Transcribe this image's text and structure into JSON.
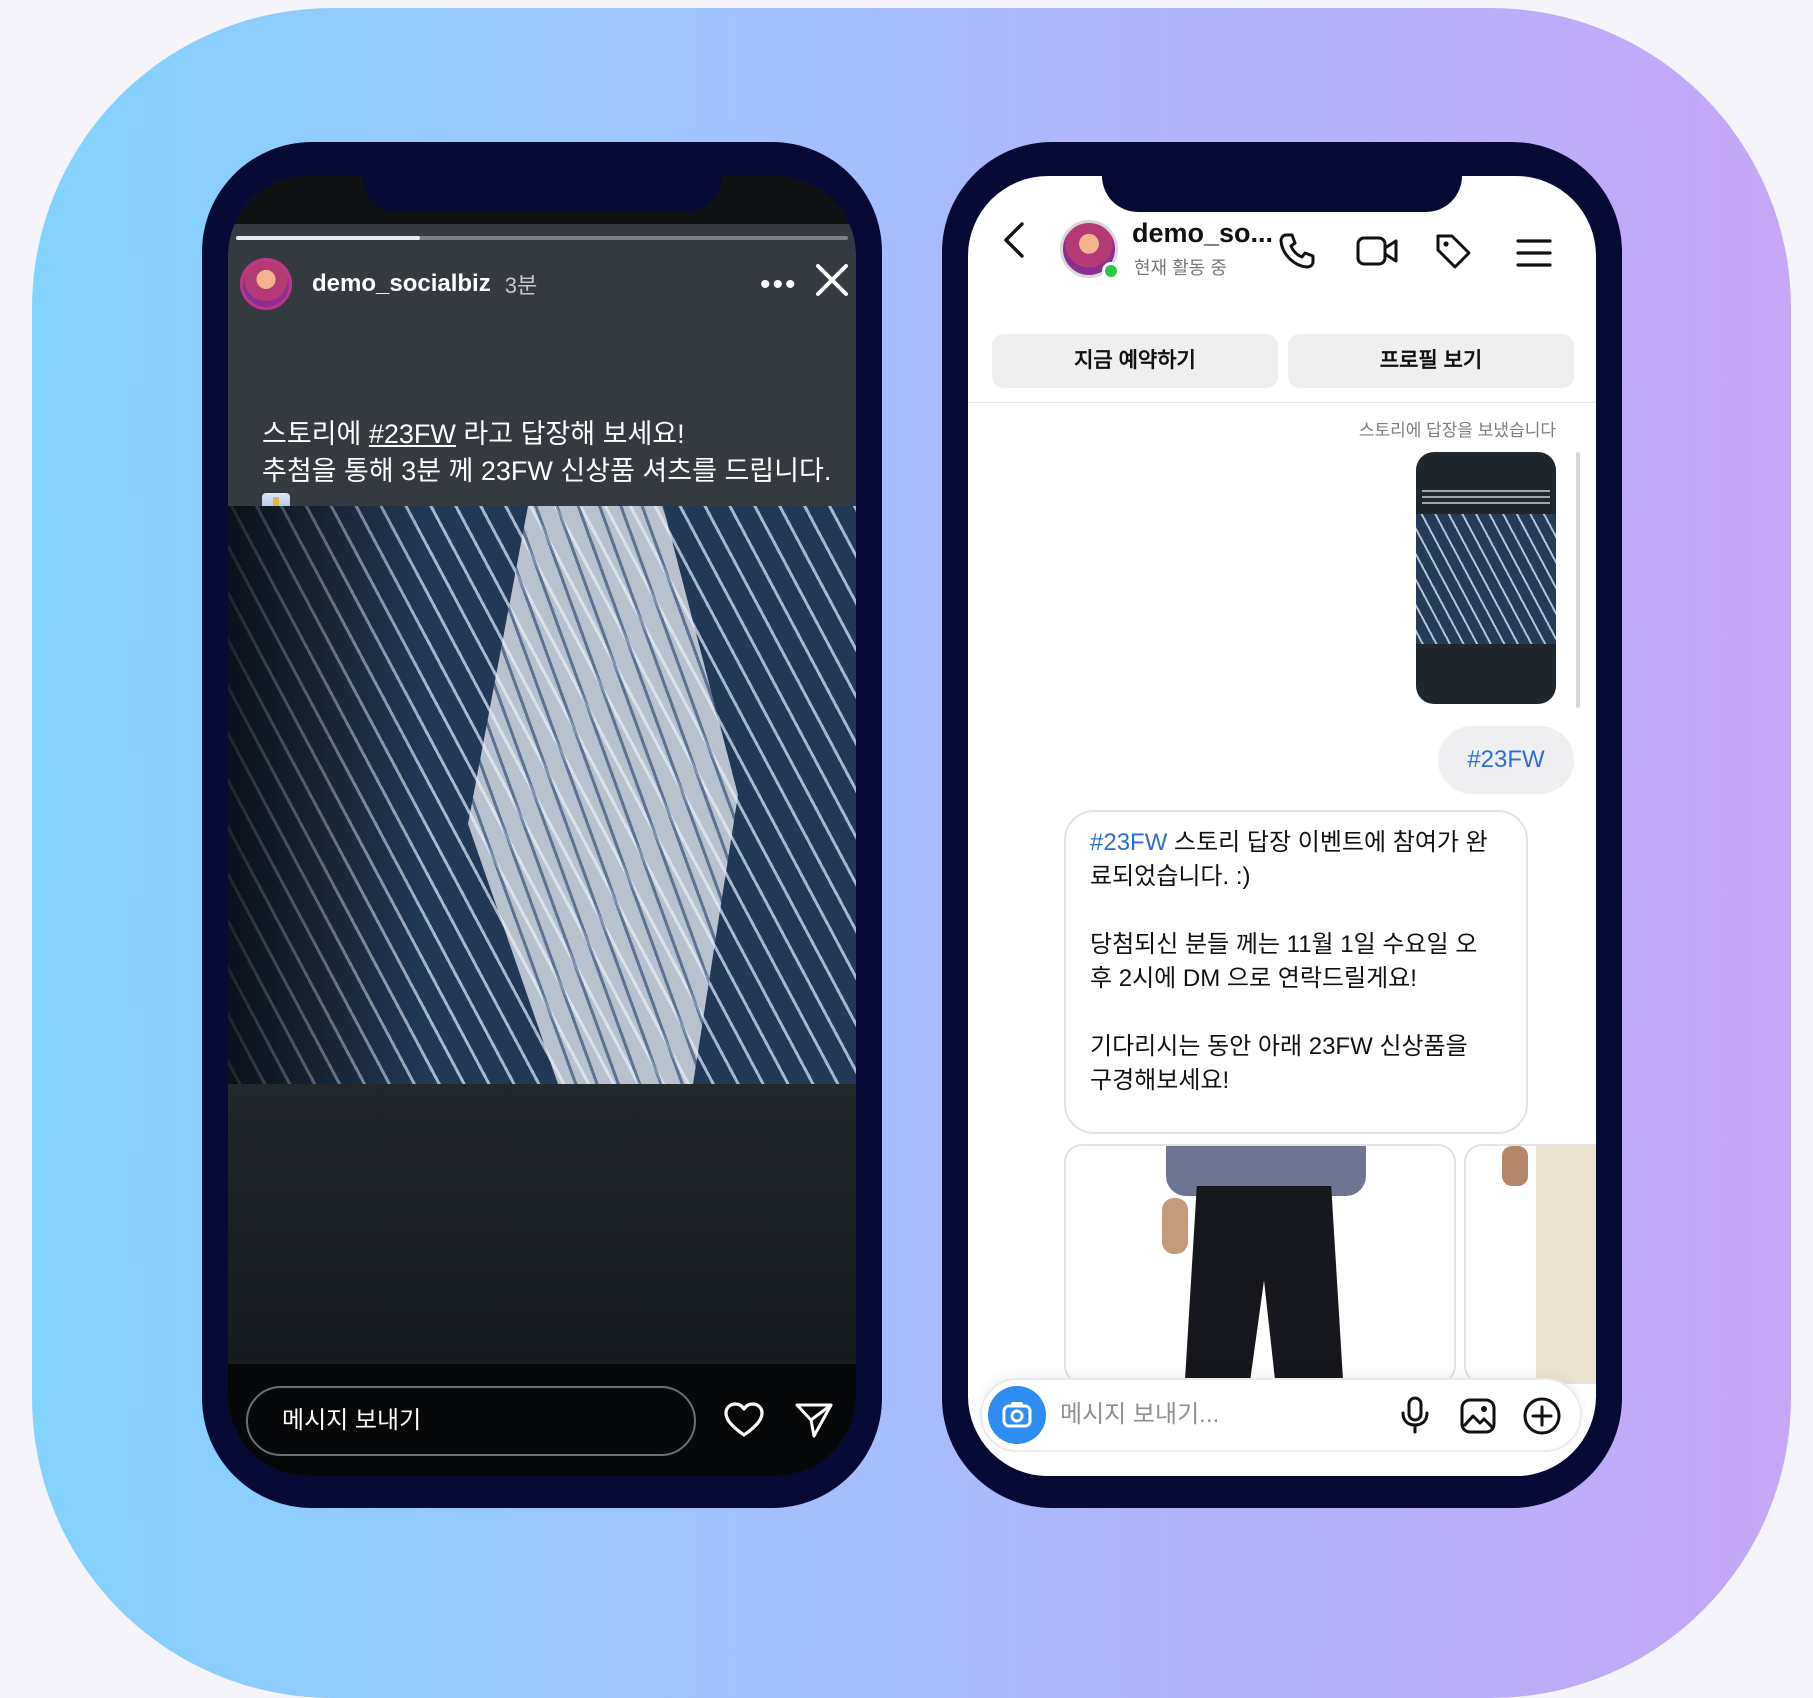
{
  "story": {
    "username": "demo_socialbiz",
    "time": "3분",
    "progress": 0.3,
    "text_line1_before": "스토리에 ",
    "text_line1_tag": "#23FW",
    "text_line1_after": " 라고 답장해 보세요!",
    "text_line2": "추첨을 통해 3분 께 23FW 신상품 셔츠를 드립니다. ",
    "message_placeholder": "메시지 보내기",
    "icons": [
      "more-icon",
      "close-icon",
      "heart-icon",
      "send-icon"
    ]
  },
  "dm": {
    "username": "demo_so...",
    "status": "현재 활동 중",
    "buttons": {
      "book_now": "지금 예약하기",
      "view_profile": "프로필 보기"
    },
    "reply_note": "스토리에 답장을 보냈습니다",
    "sent_message": "#23FW",
    "received": {
      "tag": "#23FW",
      "line1_after_tag": " 스토리 답장 이벤트에 참여가 완",
      "line2": "료되었습니다. :)",
      "line3": "당첨되신 분들 께는 11월 1일 수요일 오",
      "line4": "후 2시에 DM 으로 연락드릴게요!",
      "line5": "기다리시는 동안 아래 23FW 신상품을",
      "line6": "구경해보세요!"
    },
    "composer_placeholder": "메시지 보내기...",
    "colors": {
      "link": "#2c6ed1",
      "online": "#2cc649",
      "camera": "#2f8cf0"
    },
    "icons": [
      "back-icon",
      "phone-icon",
      "video-icon",
      "tag-icon",
      "menu-icon",
      "camera-icon",
      "mic-icon",
      "image-icon",
      "plus-icon"
    ]
  }
}
